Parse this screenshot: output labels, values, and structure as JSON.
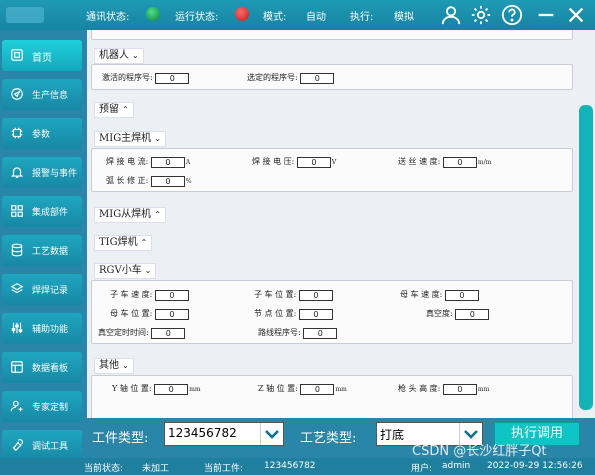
{
  "topbar": {
    "comm_label": "通讯状态:",
    "run_label": "运行状态:",
    "mode_label": "模式:",
    "mode_value": "自动",
    "exec_label": "执行:",
    "exec_value": "模拟",
    "comm_color": "#1aa855",
    "run_color": "#e02020",
    "icons": [
      "user-icon",
      "gear-icon",
      "help-icon",
      "minimize-icon",
      "close-icon"
    ]
  },
  "sidebar": {
    "items": [
      {
        "label": "首页",
        "icon": "home-icon"
      },
      {
        "label": "生产信息",
        "icon": "production-icon"
      },
      {
        "label": "参数",
        "icon": "parameter-icon"
      },
      {
        "label": "报警与事件",
        "icon": "bell-icon"
      },
      {
        "label": "集成部件",
        "icon": "grid-icon"
      },
      {
        "label": "工艺数据",
        "icon": "database-icon"
      },
      {
        "label": "焊焊记录",
        "icon": "layers-icon"
      },
      {
        "label": "辅助功能",
        "icon": "sliders-icon"
      },
      {
        "label": "数据看板",
        "icon": "dashboard-icon"
      },
      {
        "label": "专家定制",
        "icon": "user-add-icon"
      },
      {
        "label": "调试工具",
        "icon": "wrench-icon"
      }
    ]
  },
  "sections": {
    "robot": {
      "title": "机器人",
      "active_prog_label": "激活的程序号:",
      "active_prog_value": "0",
      "selected_prog_label": "选定的程序号:",
      "selected_prog_value": "0"
    },
    "reserved": {
      "title": "预留"
    },
    "mig_main": {
      "title": "MIG主焊机",
      "current_label": "焊 接 电 流:",
      "current_value": "0",
      "current_unit": "A",
      "voltage_label": "焊 接 电 压:",
      "voltage_value": "0",
      "voltage_unit": "V",
      "wire_label": "送 丝 速 度:",
      "wire_value": "0",
      "wire_unit": "m/m",
      "arc_label": "弧 长 修 正:",
      "arc_value": "0",
      "arc_unit": "%"
    },
    "mig_slave": {
      "title": "MIG从焊机"
    },
    "tig": {
      "title": "TIG焊机"
    },
    "rgv": {
      "title": "RGV小车",
      "sub_speed_label": "子 车 速 度:",
      "sub_speed_value": "0",
      "sub_pos_label": "子 车 位 置:",
      "sub_pos_value": "0",
      "mother_speed_label": "母 车 速 度:",
      "mother_speed_value": "0",
      "mother_pos_label": "母 车 位 置:",
      "mother_pos_value": "0",
      "node_pos_label": "节 点 位 置:",
      "node_pos_value": "0",
      "vacuum_label": "真空度:",
      "vacuum_value": "0",
      "vacuum_timer_label": "真空定时时间:",
      "vacuum_timer_value": "0",
      "route_label": "路线程序号:",
      "route_value": "0"
    },
    "other": {
      "title": "其他",
      "y_label": "Y 轴 位 置:",
      "y_value": "0",
      "y_unit": "mm",
      "z_label": "Z 轴 位 置:",
      "z_value": "0",
      "z_unit": "mm",
      "gun_label": "枪 头 高 度:",
      "gun_value": "0",
      "gun_unit": "mm"
    }
  },
  "toolbar": {
    "part_type_label": "工件类型:",
    "part_type_value": "123456782",
    "process_type_label": "工艺类型:",
    "process_type_value": "打底",
    "execute_label": "执行调用"
  },
  "statusbar": {
    "current_state_label": "当前状态:",
    "current_state_value": "未加工",
    "current_part_label": "当前工件:",
    "current_part_value": "123456782",
    "user_label": "用户:",
    "user_value": "admin",
    "datetime": "2022-09-29 12:56:26"
  },
  "watermark": "CSDN @长沙红胖子Qt"
}
